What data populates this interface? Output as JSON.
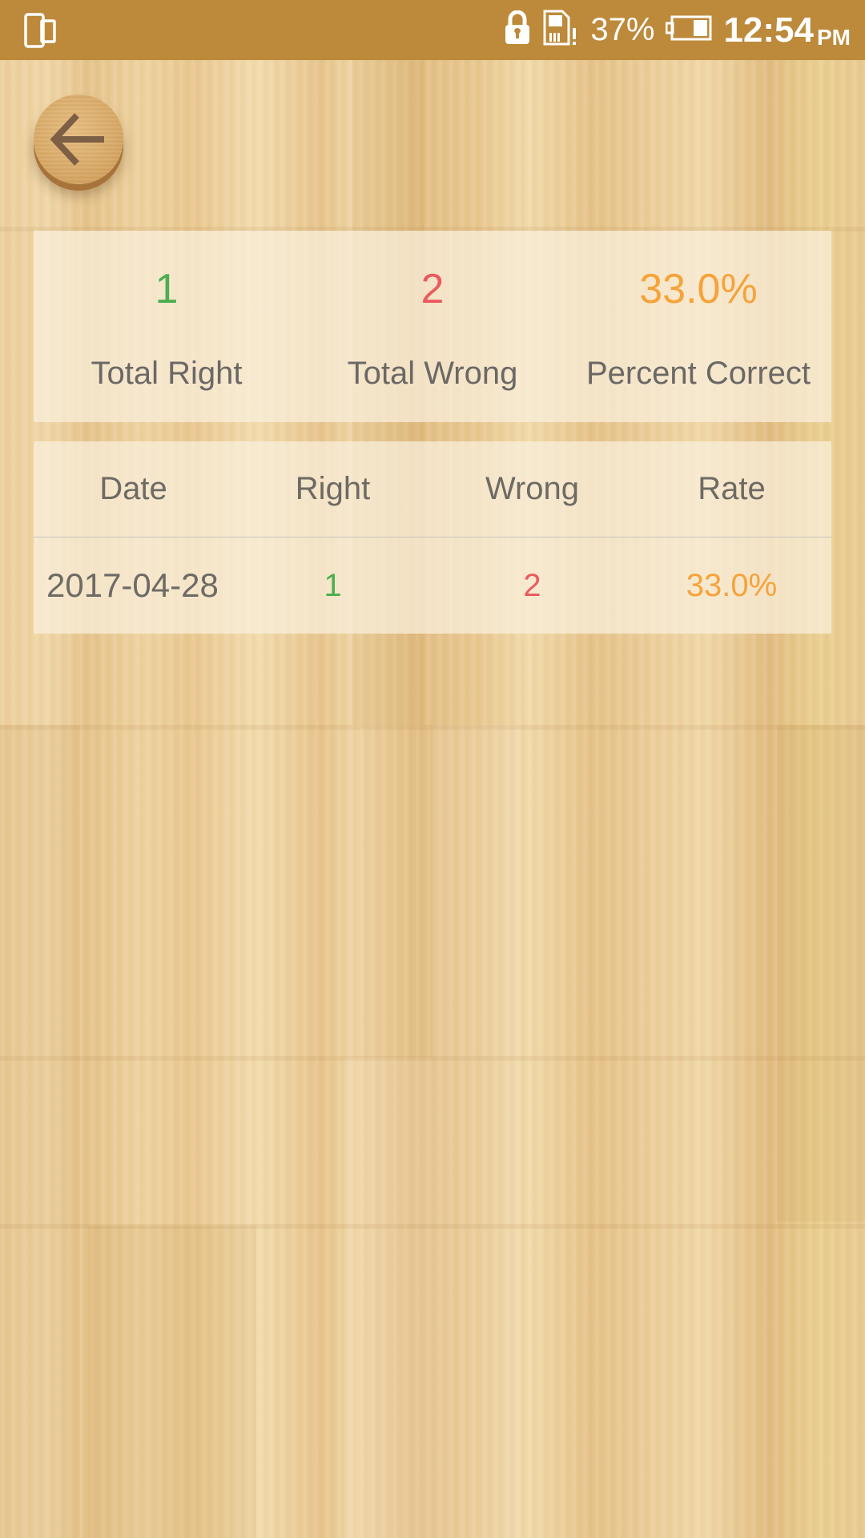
{
  "status_bar": {
    "left_icon": "screen-mirror-icon",
    "icons": [
      "lock-icon",
      "sim-alert-icon",
      "battery-icon"
    ],
    "battery_percent": "37%",
    "time": "12:54",
    "ampm": "PM"
  },
  "navigation": {
    "back_icon": "arrow-left-icon"
  },
  "colors": {
    "right": "#4cae50",
    "wrong": "#ea5b5f",
    "percent": "#f6a33a",
    "status_bar": "#bc8a3a",
    "text": "#6b6866"
  },
  "summary": {
    "total_right": {
      "value": "1",
      "label": "Total Right"
    },
    "total_wrong": {
      "value": "2",
      "label": "Total Wrong"
    },
    "percent_correct": {
      "value": "33.0%",
      "label": "Percent Correct"
    }
  },
  "history": {
    "columns": [
      "Date",
      "Right",
      "Wrong",
      "Rate"
    ],
    "rows": [
      {
        "date": "2017-04-28",
        "right": "1",
        "wrong": "2",
        "rate": "33.0%"
      }
    ]
  }
}
